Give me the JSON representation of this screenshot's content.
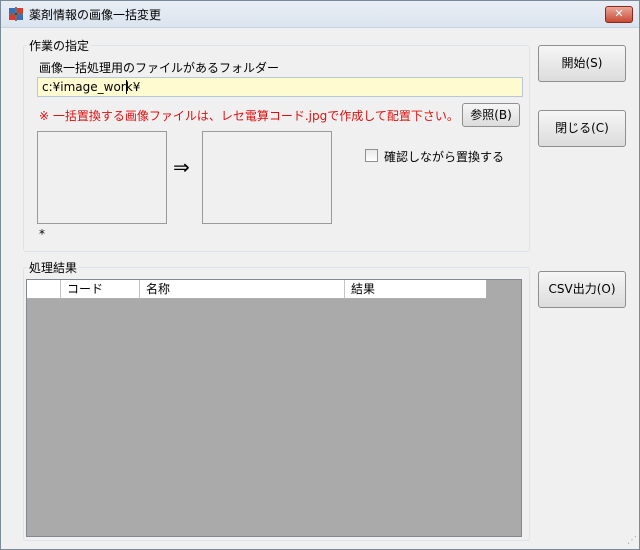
{
  "window": {
    "title": "薬剤情報の画像一括変更",
    "close_label": "✕"
  },
  "task_group": {
    "legend": "作業の指定",
    "folder_label": "画像一括処理用のファイルがあるフォルダー",
    "folder_value": "c:¥image_work¥",
    "note": "※ 一括置換する画像ファイルは、レセ電算コード.jpgで作成して配置下さい。",
    "browse_label": "参照(B)",
    "arrow": "⇒",
    "asterisk": "*",
    "confirm_label": "確認しながら置換する",
    "confirm_checked": false
  },
  "buttons": {
    "start": "開始(S)",
    "close": "閉じる(C)",
    "csv": "CSV出力(O)"
  },
  "result_group": {
    "legend": "処理結果",
    "columns": [
      "",
      "コード",
      "名称",
      "結果"
    ],
    "rows": []
  }
}
